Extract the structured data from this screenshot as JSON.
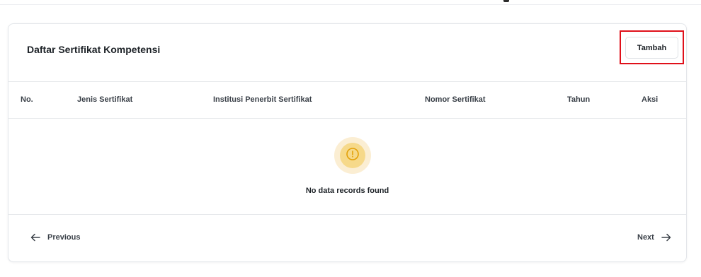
{
  "card": {
    "title": "Daftar Sertifikat Kompetensi",
    "add_button_label": "Tambah"
  },
  "table": {
    "columns": [
      "No.",
      "Jenis Sertifikat",
      "Institusi Penerbit Sertifikat",
      "Nomor Sertifikat",
      "Tahun",
      "Aksi"
    ],
    "rows": [],
    "empty_message": "No data records found"
  },
  "pagination": {
    "previous_label": "Previous",
    "next_label": "Next"
  },
  "colors": {
    "highlight_border": "#e0101a",
    "empty_icon_bg": "#fbeed3",
    "empty_icon_fg": "#e3a008"
  },
  "icons": {
    "empty_state": "alert-circle-icon",
    "previous": "arrow-left-icon",
    "next": "arrow-right-icon"
  }
}
